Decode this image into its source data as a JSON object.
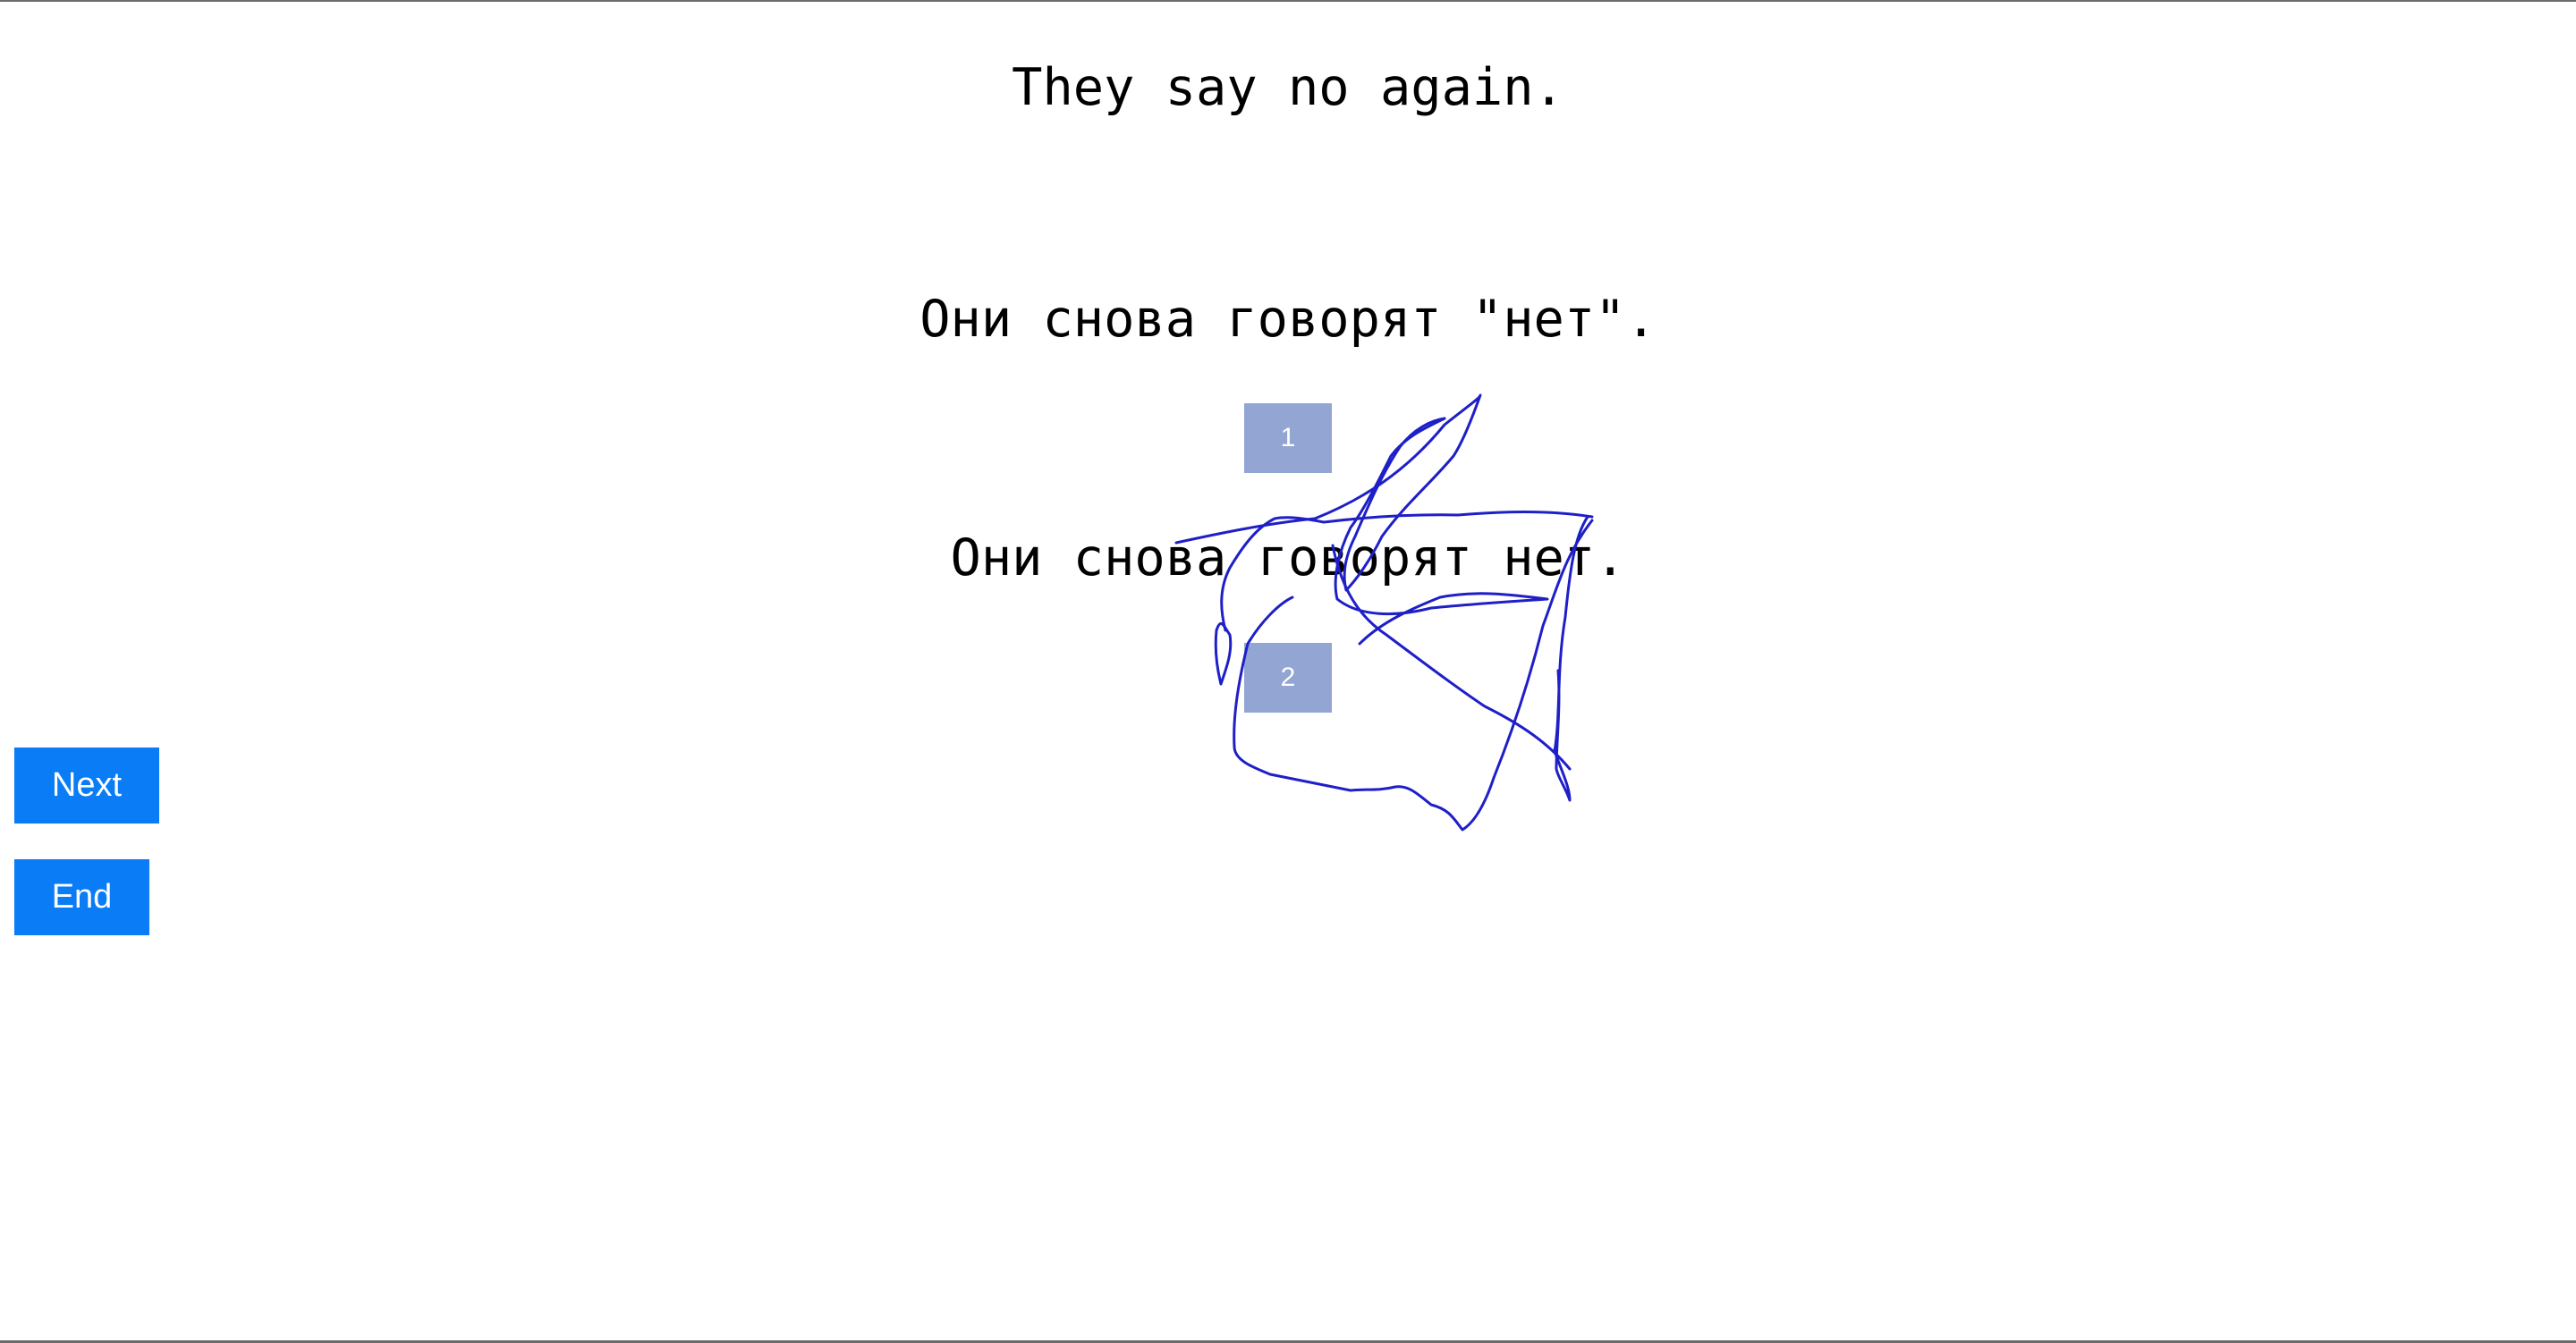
{
  "source": {
    "text": "They say no again."
  },
  "translations": [
    {
      "text": "Они снова говорят \"нет\"."
    },
    {
      "text": "Они снова говорят нет."
    }
  ],
  "rank_boxes": [
    {
      "label": "1"
    },
    {
      "label": "2"
    }
  ],
  "buttons": {
    "next_label": "Next",
    "end_label": "End"
  },
  "colors": {
    "button": "#0a7cf6",
    "rank_box": "#93a6d3",
    "pen_stroke": "#1f1fc8"
  }
}
